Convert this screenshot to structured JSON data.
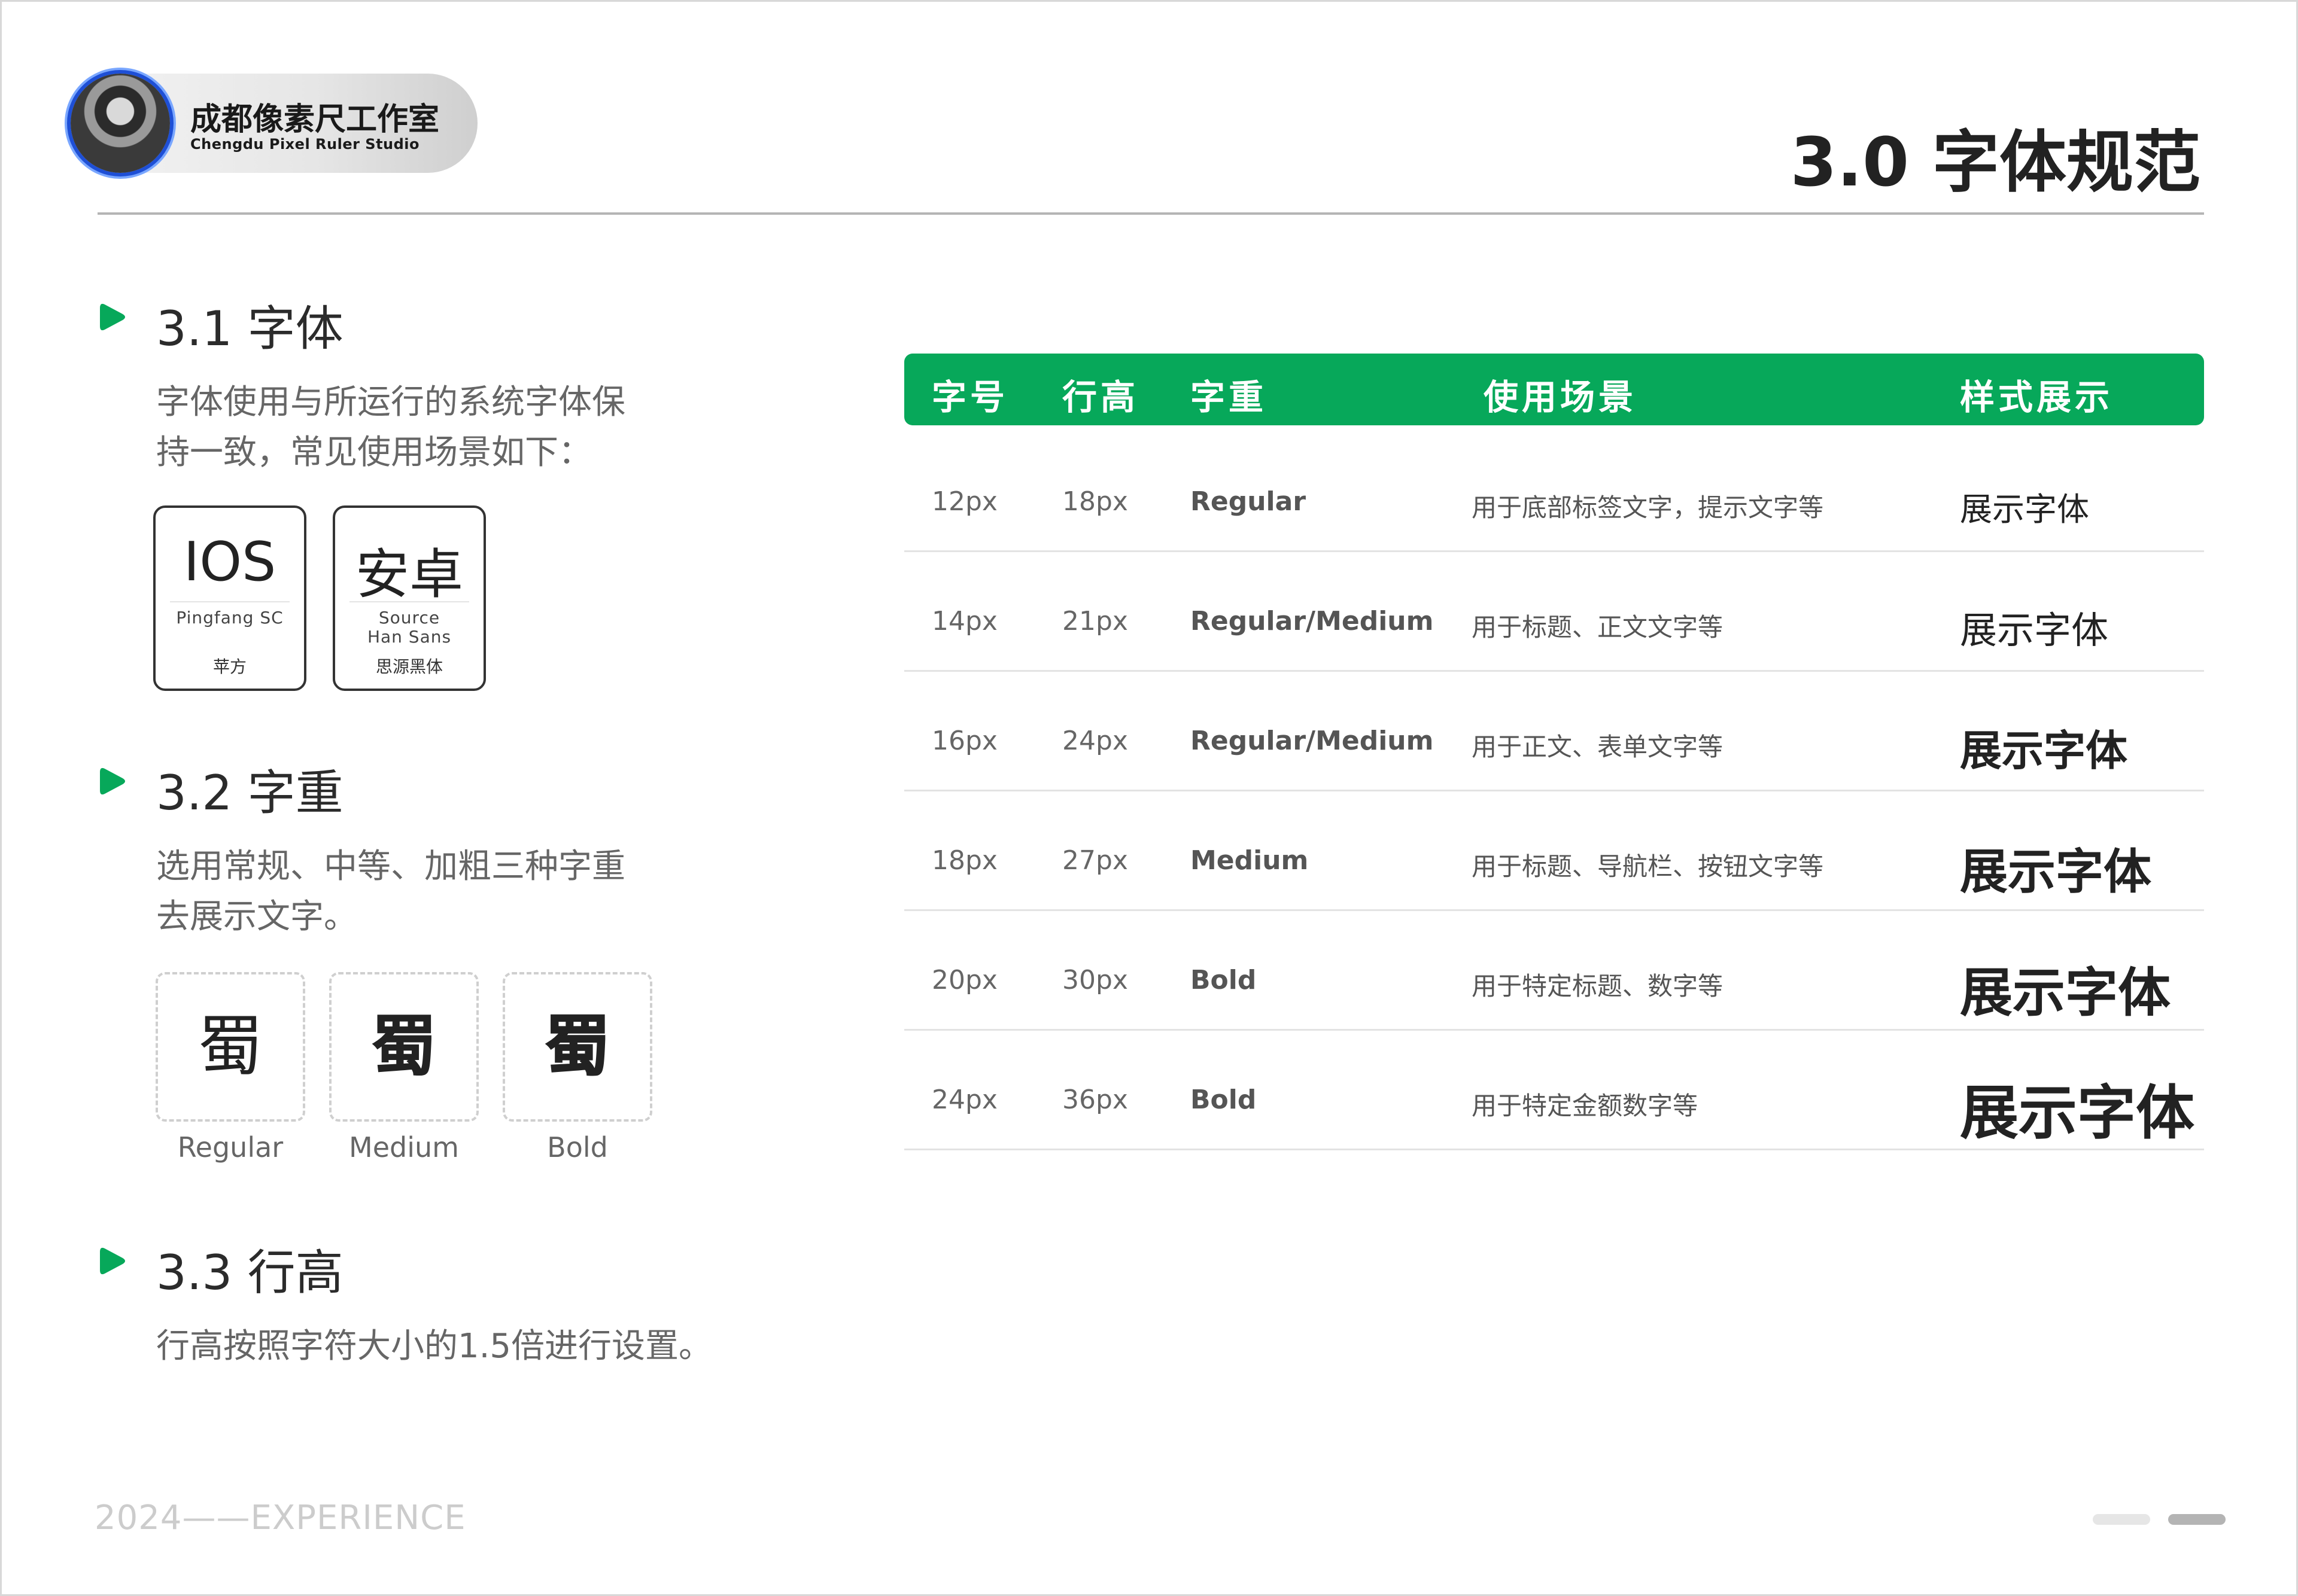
{
  "brand": {
    "name": "成都像素尺工作室",
    "subtitle": "Chengdu Pixel Ruler Studio"
  },
  "page_title": "3.0 字体规范",
  "accent_color": "#07a85a",
  "sections": {
    "font": {
      "title": "3.1 字体",
      "desc_line1": "字体使用与所运行的系统字体保",
      "desc_line2": "持一致，常见使用场景如下：",
      "cards": [
        {
          "big": "IOS",
          "en": "Pingfang SC",
          "cn": "苹方"
        },
        {
          "big": "安卓",
          "en": "Source Han Sans",
          "cn": "思源黑体"
        }
      ]
    },
    "weight": {
      "title": "3.2 字重",
      "desc_line1": "选用常规、中等、加粗三种字重",
      "desc_line2": "去展示文字。",
      "samples": [
        {
          "char": "蜀",
          "label": "Regular"
        },
        {
          "char": "蜀",
          "label": "Medium"
        },
        {
          "char": "蜀",
          "label": "Bold"
        }
      ]
    },
    "line_height": {
      "title": "3.3 行高",
      "desc": "行高按照字符大小的1.5倍进行设置。"
    }
  },
  "table": {
    "headers": {
      "size": "字号",
      "line_height": "行高",
      "weight": "字重",
      "usage": "使用场景",
      "demo": "样式展示"
    },
    "rows": [
      {
        "size": "12px",
        "line_height": "18px",
        "weight": "Regular",
        "usage": "用于底部标签文字，提示文字等",
        "demo": "展示字体"
      },
      {
        "size": "14px",
        "line_height": "21px",
        "weight": "Regular/Medium",
        "usage": "用于标题、正文文字等",
        "demo": "展示字体"
      },
      {
        "size": "16px",
        "line_height": "24px",
        "weight": "Regular/Medium",
        "usage": "用于正文、表单文字等",
        "demo": "展示字体"
      },
      {
        "size": "18px",
        "line_height": "27px",
        "weight": "Medium",
        "usage": "用于标题、导航栏、按钮文字等",
        "demo": "展示字体"
      },
      {
        "size": "20px",
        "line_height": "30px",
        "weight": "Bold",
        "usage": "用于特定标题、数字等",
        "demo": "展示字体"
      },
      {
        "size": "24px",
        "line_height": "36px",
        "weight": "Bold",
        "usage": "用于特定金额数字等",
        "demo": "展示字体"
      }
    ]
  },
  "footer": {
    "text": "2024——EXPERIENCE"
  },
  "pager": {
    "current_page": 2,
    "total_pages": 2
  }
}
